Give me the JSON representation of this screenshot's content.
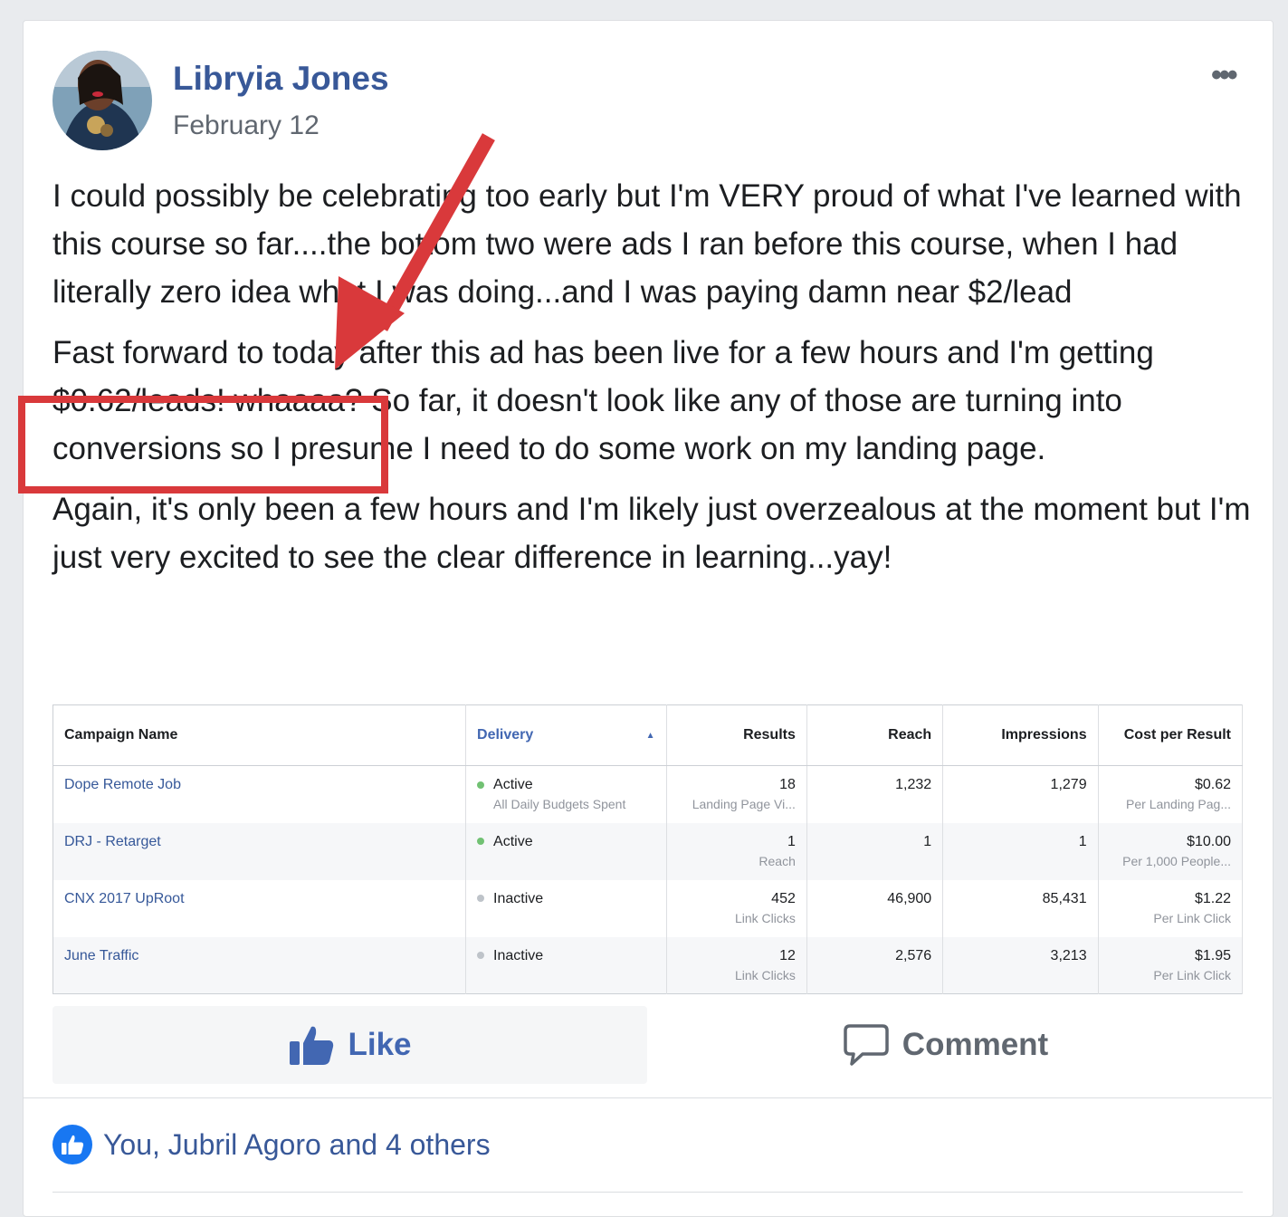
{
  "post": {
    "author": "Libryia Jones",
    "date": "February 12",
    "paragraph1": "I could possibly be celebrating too early but I'm VERY proud of what I've learned with this course so far....the bottom two were ads I ran before this course, when I had literally zero idea what I was doing...and I was paying damn near $2/lead",
    "paragraph2": "Fast forward to today after this ad has been live for a few hours and I'm getting $0.62/leads! whaaaa? So far, it doesn't look like any of those are turning into conversions so I presume I need to do some work on my landing page.",
    "paragraph3": "Again, it's only been a few hours and I'm likely just overzealous at the moment but I'm just very excited to see the clear difference in learning...yay!"
  },
  "table": {
    "headers": [
      "Campaign Name",
      "Delivery",
      "Results",
      "Reach",
      "Impressions",
      "Cost per Result"
    ],
    "rows": [
      {
        "name": "Dope Remote Job",
        "status": "Active",
        "status_sub": "All Daily Budgets Spent",
        "results": "18",
        "results_sub": "Landing Page Vi...",
        "reach": "1,232",
        "impressions": "1,279",
        "cost": "$0.62",
        "cost_sub": "Per Landing Pag..."
      },
      {
        "name": "DRJ - Retarget",
        "status": "Active",
        "status_sub": "",
        "results": "1",
        "results_sub": "Reach",
        "reach": "1",
        "impressions": "1",
        "cost": "$10.00",
        "cost_sub": "Per 1,000 People..."
      },
      {
        "name": "CNX 2017 UpRoot",
        "status": "Inactive",
        "status_sub": "",
        "results": "452",
        "results_sub": "Link Clicks",
        "reach": "46,900",
        "impressions": "85,431",
        "cost": "$1.22",
        "cost_sub": "Per Link Click"
      },
      {
        "name": "June Traffic",
        "status": "Inactive",
        "status_sub": "",
        "results": "12",
        "results_sub": "Link Clicks",
        "reach": "2,576",
        "impressions": "3,213",
        "cost": "$1.95",
        "cost_sub": "Per Link Click"
      }
    ]
  },
  "actions": {
    "like": "Like",
    "comment": "Comment"
  },
  "reactions": {
    "text": "You, Jubril Agoro and 4 others"
  },
  "colors": {
    "accent": "#d9393b",
    "link": "#385898",
    "like": "#4267b2"
  }
}
